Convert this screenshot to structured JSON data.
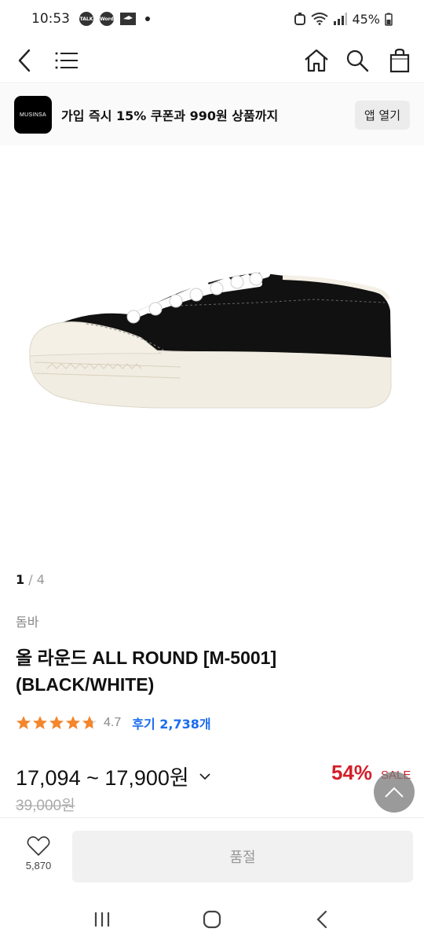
{
  "status_bar": {
    "time": "10:53",
    "battery": "45%",
    "notif_talk": "TALK",
    "notif_word": "Word"
  },
  "banner": {
    "logo_text": "MUSINSA",
    "text": "가입 즉시 15% 쿠폰과 990원 상품까지",
    "button": "앱 열기"
  },
  "gallery": {
    "current": "1",
    "separator": " / ",
    "total": "4"
  },
  "product": {
    "brand": "돔바",
    "title_line1": "올 라운드 ALL ROUND [M-5001]",
    "title_line2": "(BLACK/WHITE)",
    "rating": "4.7",
    "rating_value": 4.7,
    "reviews": "후기 2,738개",
    "price": "17,094 ~ 17,900원",
    "discount": "54%",
    "sale_label": "SALE",
    "original_price": "39,000원"
  },
  "action_bar": {
    "like_count": "5,870",
    "soldout_label": "품절"
  },
  "icons": {
    "back": "back-chevron-icon",
    "menu": "menu-icon",
    "home": "home-icon",
    "search": "search-icon",
    "bag": "shopping-bag-icon",
    "heart": "heart-icon",
    "scroll_top": "chevron-up-icon"
  },
  "colors": {
    "accent_blue": "#1a6cf0",
    "sale_red": "#d21f2a",
    "star_orange": "#f4862c"
  }
}
